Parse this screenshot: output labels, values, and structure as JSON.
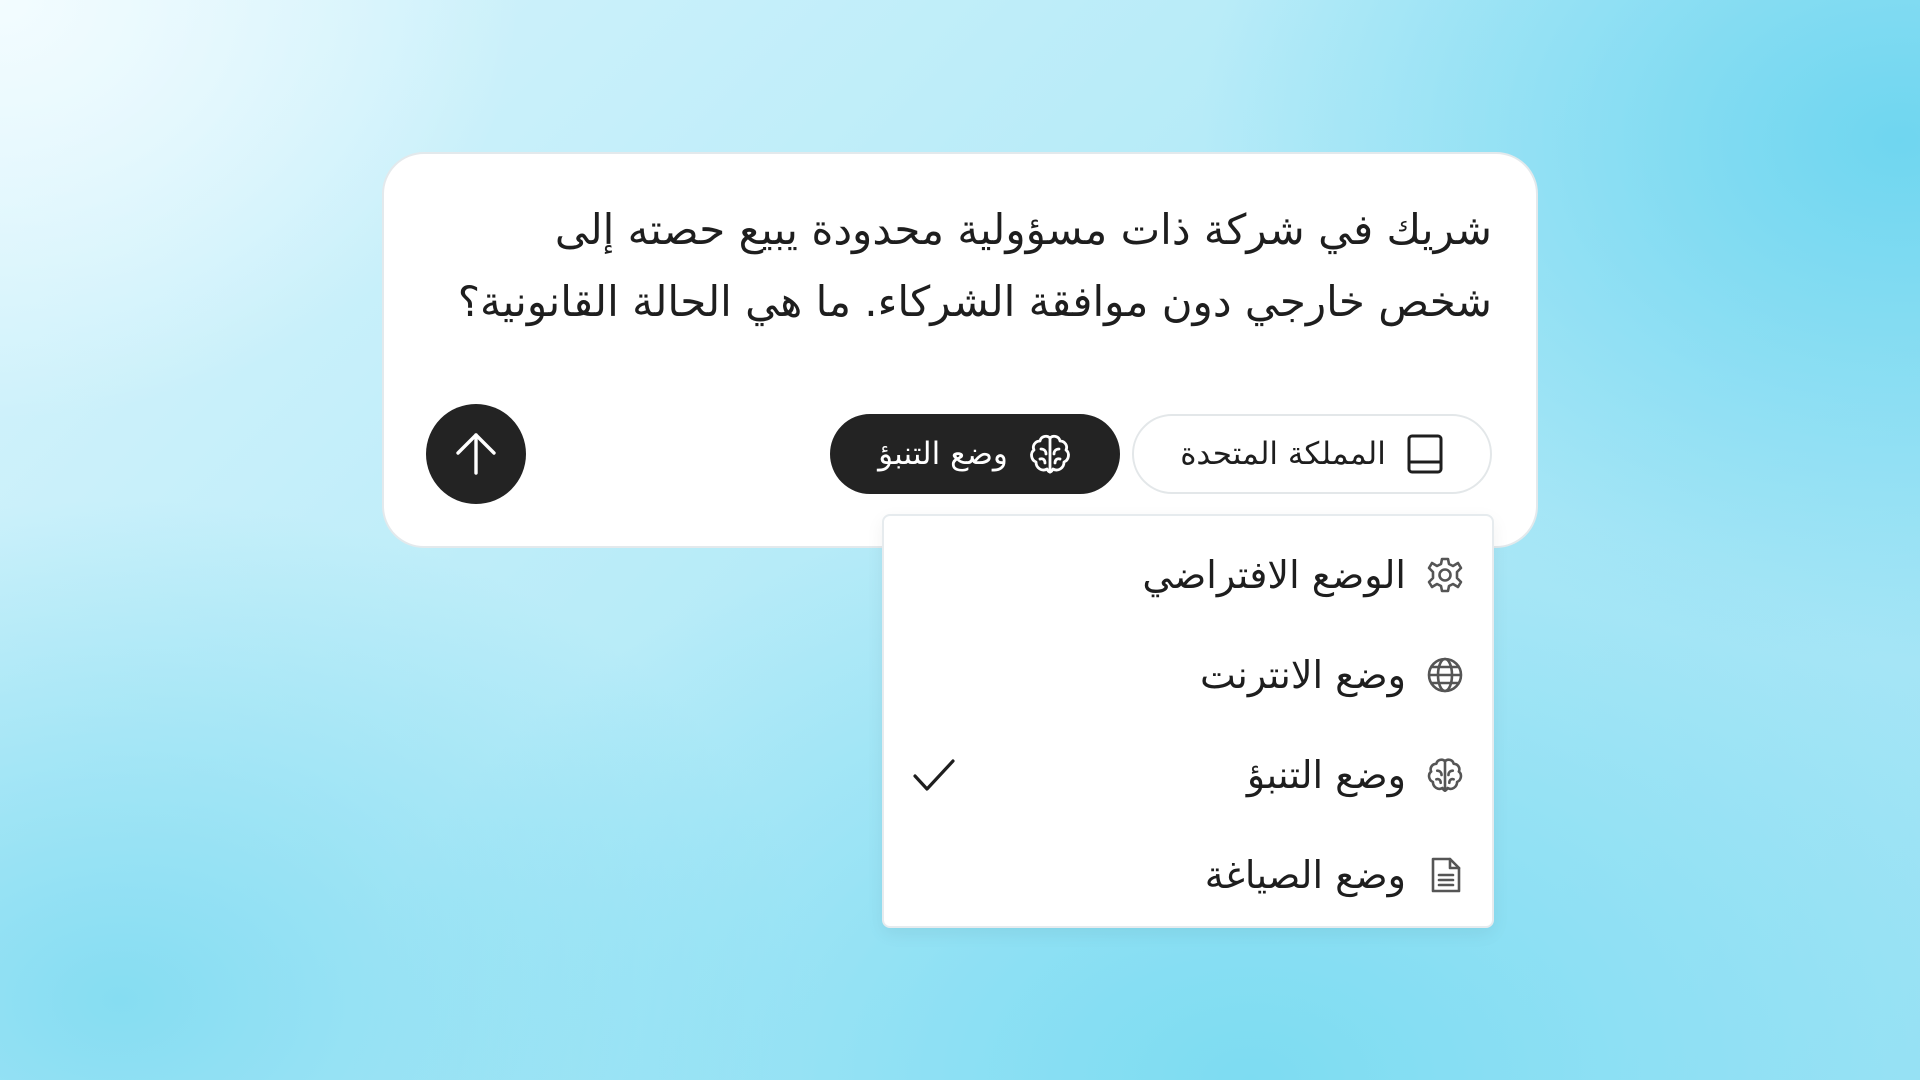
{
  "prompt": {
    "text": "شريك في شركة ذات مسؤولية محدودة يبيع حصته إلى شخص خارجي دون موافقة الشركاء. ما هي الحالة القانونية؟"
  },
  "toolbar": {
    "region_label": "المملكة المتحدة",
    "region_icon": "book-icon",
    "mode_label": "وضع التنبؤ",
    "mode_icon": "brain-icon",
    "send_icon": "arrow-up-icon"
  },
  "mode_menu": {
    "items": [
      {
        "label": "الوضع الافتراضي",
        "icon": "gear-icon",
        "selected": false
      },
      {
        "label": "وضع الانترنت",
        "icon": "globe-icon",
        "selected": false
      },
      {
        "label": "وضع التنبؤ",
        "icon": "brain-icon",
        "selected": true
      },
      {
        "label": "وضع الصياغة",
        "icon": "document-icon",
        "selected": false
      }
    ]
  },
  "colors": {
    "card_bg": "#ffffff",
    "dark_accent": "#232323",
    "text": "#1e1e1e"
  }
}
